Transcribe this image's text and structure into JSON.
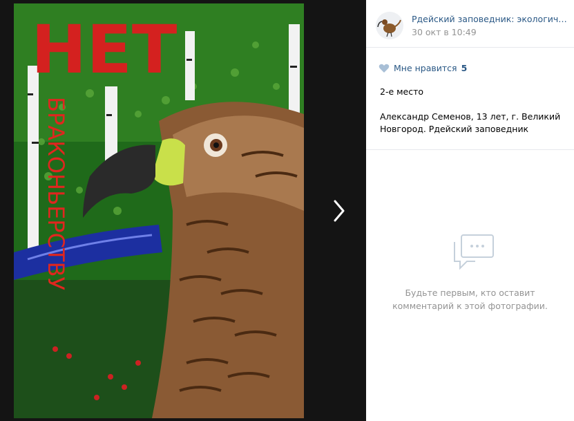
{
  "viewer": {
    "photo_alt": "НЕТ браконьерству",
    "poster_title": "НЕТ",
    "poster_vertical_text": "БРАКОНЬЕРСТВУ",
    "next_icon": "chevron-right-icon"
  },
  "author": {
    "name": "Рдейский заповедник: экологическ…",
    "date": "30 окт в 10:49"
  },
  "likes": {
    "label": "Мне нравится",
    "count": "5",
    "icon": "heart-icon",
    "color": "#2a5885"
  },
  "description": {
    "place": "2-е место",
    "line2": "Александр Семенов, 13 лет, г. Великий",
    "line3": "Новгород. Рдейский заповедник"
  },
  "comments": {
    "empty_line1": "Будьте первым, кто оставит",
    "empty_line2": "комментарий к этой фотографии.",
    "icon": "comment-bubble-icon"
  }
}
